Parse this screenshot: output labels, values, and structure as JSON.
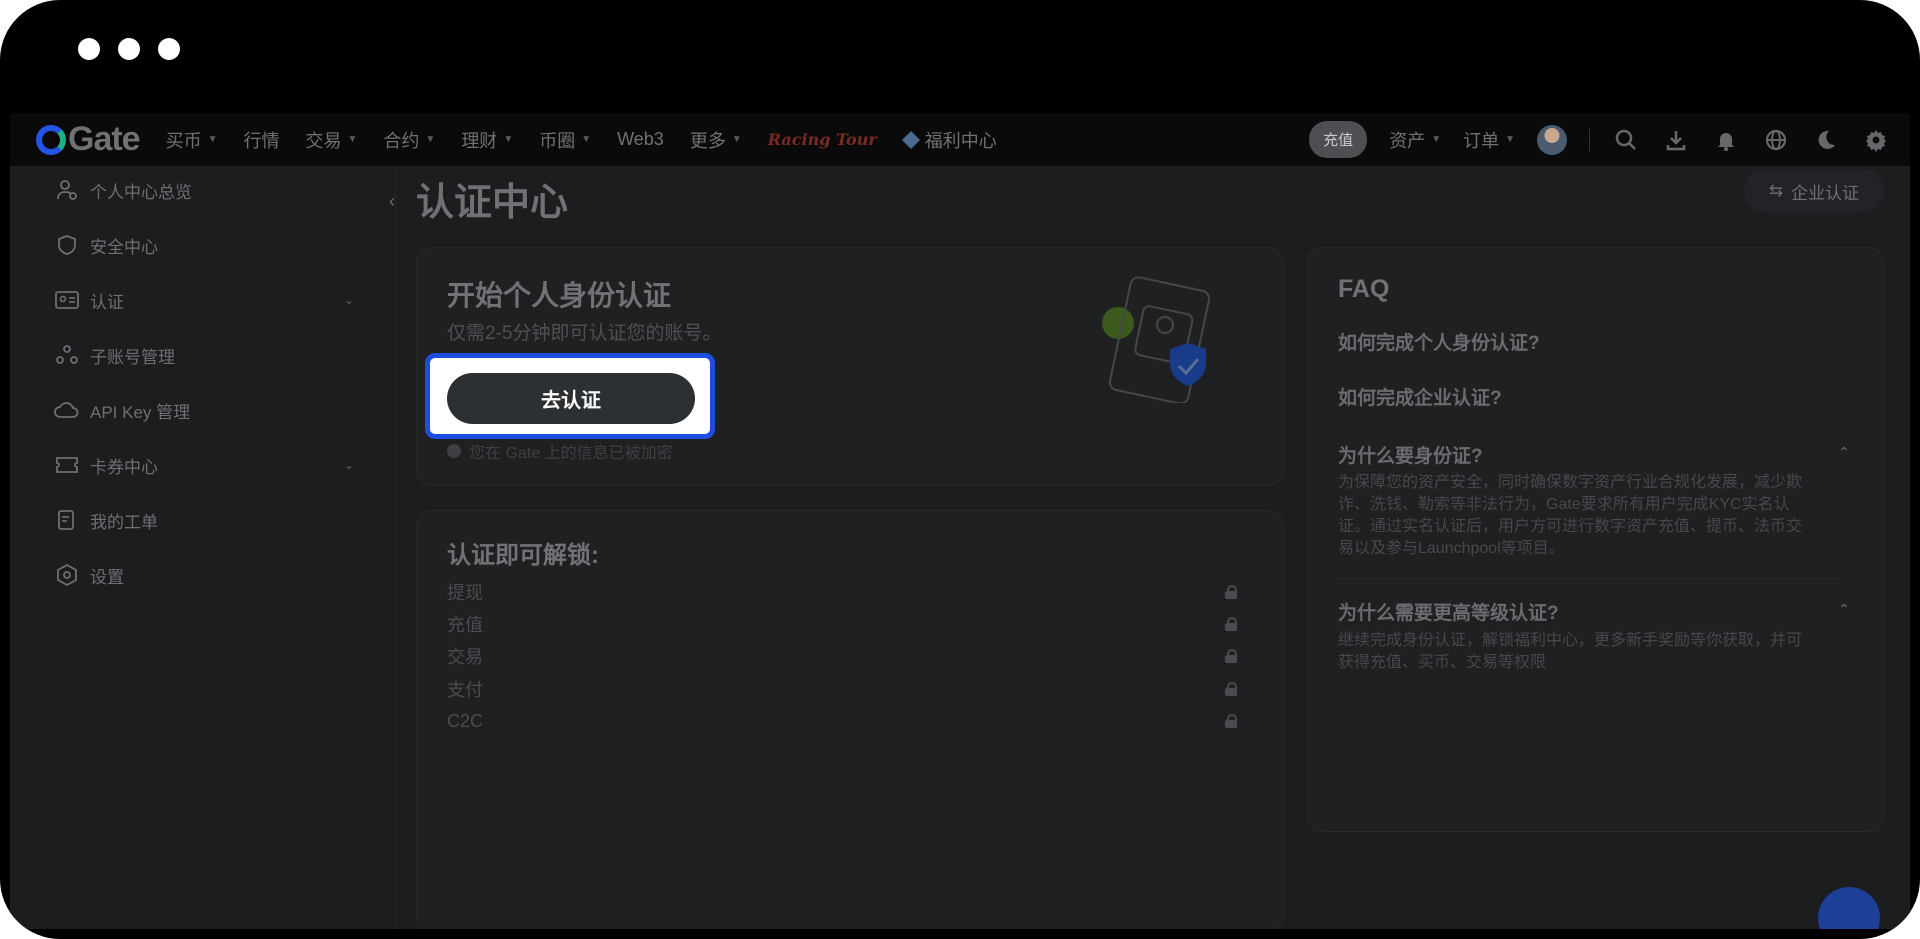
{
  "nav": {
    "logo_text": "Gate",
    "items": [
      {
        "label": "买币",
        "caret": true
      },
      {
        "label": "行情",
        "caret": false
      },
      {
        "label": "交易",
        "caret": true
      },
      {
        "label": "合约",
        "caret": true
      },
      {
        "label": "理财",
        "caret": true
      },
      {
        "label": "币圈",
        "caret": true
      },
      {
        "label": "Web3",
        "caret": false
      },
      {
        "label": "更多",
        "caret": true
      }
    ],
    "racing_tour": "Racing Tour",
    "welfare": "福利中心",
    "recharge": "充值",
    "assets": "资产",
    "orders": "订单"
  },
  "sidebar": {
    "items": [
      {
        "label": "个人中心总览",
        "icon": "user-icon"
      },
      {
        "label": "安全中心",
        "icon": "shield-icon"
      },
      {
        "label": "认证",
        "icon": "id-card-icon",
        "expand": true
      },
      {
        "label": "子账号管理",
        "icon": "sub-account-icon"
      },
      {
        "label": "API Key 管理",
        "icon": "api-icon"
      },
      {
        "label": "卡券中心",
        "icon": "coupon-icon",
        "expand": true
      },
      {
        "label": "我的工单",
        "icon": "ticket-icon"
      },
      {
        "label": "设置",
        "icon": "settings-icon"
      }
    ]
  },
  "main": {
    "title": "认证中心",
    "company_cert": "企业认证",
    "start": {
      "title": "开始个人身份认证",
      "subtitle": "仅需2-5分钟即可认证您的账号。",
      "button": "去认证",
      "note": "您在 Gate 上的信息已被加密"
    },
    "unlock": {
      "title": "认证即可解锁:",
      "items": [
        "提现",
        "充值",
        "交易",
        "支付",
        "C2C"
      ]
    }
  },
  "faq": {
    "title": "FAQ",
    "q1": "如何完成个人身份认证?",
    "q2": "如何完成企业认证?",
    "q3": "为什么要身份证?",
    "a3": "为保障您的资产安全，同时确保数字资产行业合规化发展，减少欺诈、洗钱、勒索等非法行为，Gate要求所有用户完成KYC实名认证。通过实名认证后，用户方可进行数字资产充值、提币、法币交易以及参与Launchpool等项目。",
    "q4": "为什么需要更高等级认证?",
    "a4": "继续完成身份认证，解锁福利中心，更多新手奖励等你获取，并可获得充值、买币、交易等权限"
  }
}
